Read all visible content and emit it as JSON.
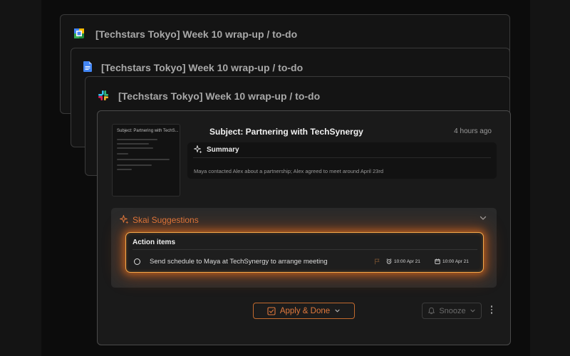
{
  "stack": [
    {
      "icon": "google-calendar-icon",
      "title": "[Techstars Tokyo] Week 10 wrap-up / to-do"
    },
    {
      "icon": "google-docs-icon",
      "title": "[Techstars Tokyo] Week 10 wrap-up / to-do"
    },
    {
      "icon": "slack-icon",
      "title": "[Techstars Tokyo] Week 10 wrap-up / to-do"
    }
  ],
  "email": {
    "subject": "Subject: Partnering with TechSynergy",
    "time": "4 hours ago",
    "thumbnail_heading": "Subject: Partnering with TechS..."
  },
  "summary": {
    "icon": "sparkle-icon",
    "title": "Summary",
    "text": "Maya contacted Alex about a partnership; Alex agreed to meet around April 23rd"
  },
  "skai": {
    "icon": "sparkle-icon",
    "title": "Skai Suggestions",
    "accent": "#e0783c",
    "action_items": {
      "title": "Action items",
      "items": [
        {
          "text": "Send schedule to Maya at TechSynergy to arrange meeting",
          "reminder": "10:00 Apr 21",
          "due": "10:00 Apr 21"
        }
      ]
    }
  },
  "actions": {
    "apply_label": "Apply & Done",
    "snooze_label": "Snooze"
  }
}
